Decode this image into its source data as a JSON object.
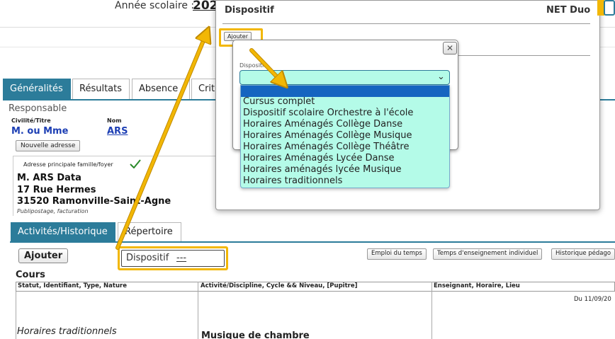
{
  "header": {
    "year_label": "Année scolaire :",
    "year_value": "202"
  },
  "tabs": [
    "Généralités",
    "Résultats",
    "Absence",
    "Crit"
  ],
  "responsable": {
    "section_label": "Responsable",
    "civilite_label": "Civilité/Titre",
    "nom_label": "Nom",
    "civilite_value": "M. ou Mme",
    "nom_value": "ARS",
    "new_address_button": "Nouvelle adresse",
    "address_title": "Adresse principale famille/foyer",
    "address_lines": [
      "M. ARS Data",
      "17 Rue Hermes",
      "31520 Ramonville-Saint-Agne"
    ],
    "address_note": "Publipostage, facturation"
  },
  "lower_tabs": [
    "Activités/Historique",
    "Répertoire"
  ],
  "activities": {
    "add_button": "Ajouter",
    "dispositif_label": "Dispositif",
    "dispositif_value": "---",
    "right_buttons": [
      "Emploi du temps",
      "Temps d'enseignement individuel",
      "Historique pédago"
    ],
    "cours_title": "Cours",
    "columns": [
      "Statut, Identifiant, Type, Nature",
      "Activité/Discipline, Cycle && Niveau, [Pupitre]",
      "Enseignant, Horaire, Lieu"
    ],
    "row_date": "Du 11/09/20",
    "row_status": "Horaires traditionnels",
    "row_activity": "Musique de chambre"
  },
  "popup": {
    "title": "Dispositif",
    "title_right": "NET Duo",
    "add_button": "Ajouter",
    "close_glyph": "✕",
    "select_label": "Dispositif",
    "select_arrow": "⌄",
    "options": [
      "",
      "Cursus complet",
      "Dispositif scolaire Orchestre à l'école",
      "Horaires Aménagés Collège Danse",
      "Horaires Aménagés Collège Musique",
      "Horaires Aménagés Collège Théâtre",
      "Horaires Aménagés Lycée Danse",
      "Horaires aménagés lycée Musique",
      "Horaires traditionnels"
    ]
  },
  "icons": {
    "check": "check-icon",
    "close": "close-icon",
    "chevron": "chevron-down-icon"
  },
  "colors": {
    "accent": "#2c7c9a",
    "highlight": "#f2b705",
    "link": "#1d3fb4",
    "select_bg": "#b4fbe8",
    "selected_option": "#1565c0"
  }
}
